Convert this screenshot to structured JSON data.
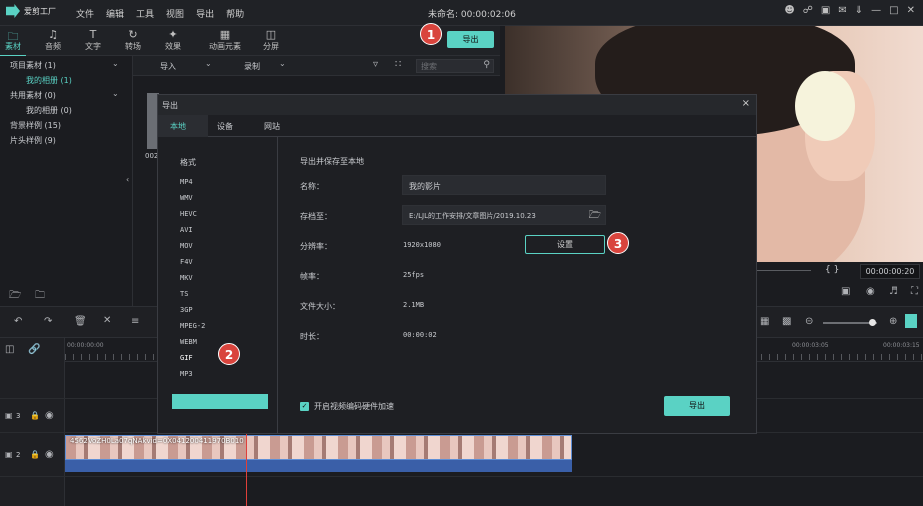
{
  "app": {
    "logo_text": "爱剪工厂",
    "menu": [
      "文件",
      "编辑",
      "工具",
      "视图",
      "导出",
      "帮助"
    ],
    "window_title": "未命名: 00:00:02:06",
    "window_icons": [
      "user-icon",
      "cart-icon",
      "save-icon",
      "mail-icon",
      "download-icon",
      "minimize-icon",
      "maximize-icon",
      "close-icon"
    ]
  },
  "toolbar": {
    "tools": [
      {
        "label": "素材",
        "icon": "folder-icon"
      },
      {
        "label": "音频",
        "icon": "music-icon"
      },
      {
        "label": "文字",
        "icon": "text-icon"
      },
      {
        "label": "转场",
        "icon": "transition-icon"
      },
      {
        "label": "效果",
        "icon": "effects-icon"
      },
      {
        "label": "动画元素",
        "icon": "image-icon"
      },
      {
        "label": "分屏",
        "icon": "split-icon"
      }
    ],
    "export_label": "导出"
  },
  "left_panel": {
    "items": [
      "项目素材 (1)",
      "我的相册 (1)",
      "共用素材 (0)",
      "我的相册 (0)",
      "背景样例 (15)",
      "片头样例 (9)"
    ]
  },
  "media_bar": {
    "import_label": "导入",
    "record_label": "录制",
    "search_placeholder": "搜索",
    "thumb_label": "002"
  },
  "preview": {
    "timecode": "00:00:00:20",
    "nav_glyph": "{ }"
  },
  "timeline": {
    "ruler_start": "00:00:00:00",
    "ruler_mid": "00:00:03:05",
    "ruler_end": "00:00:03:15",
    "tracks": [
      {
        "label": "3"
      },
      {
        "label": "2"
      }
    ],
    "clip_label": "4562VoZH0La07qNAkvid=0X041200411970B010"
  },
  "export_dialog": {
    "title": "导出",
    "tabs": [
      "本地",
      "设备",
      "网站"
    ],
    "format_header": "格式",
    "formats": [
      "MP4",
      "WMV",
      "HEVC",
      "AVI",
      "MOV",
      "F4V",
      "MKV",
      "TS",
      "3GP",
      "MPEG-2",
      "WEBM",
      "GIF",
      "MP3"
    ],
    "selected_format": "GIF",
    "section_title": "导出并保存至本地",
    "name_label": "名称：",
    "name_value": "我的影片",
    "path_label": "存档至：",
    "path_value": "E:/LJL的工作安排/文章图片/2019.10.23",
    "resolution_label": "分辨率：",
    "resolution_value": "1920x1080",
    "settings_label": "设置",
    "framerate_label": "帧率：",
    "framerate_value": "25fps",
    "filesize_label": "文件大小：",
    "filesize_value": "2.1MB",
    "duration_label": "时长：",
    "duration_value": "00:00:02",
    "hw_accel_label": "开启视频编码硬件加速",
    "hw_accel_checked": true,
    "export_label": "导出"
  },
  "badges": [
    "1",
    "2",
    "3"
  ],
  "colors": {
    "accent": "#5ad2c4",
    "badge": "#d9443d",
    "background": "#1b1c20"
  }
}
